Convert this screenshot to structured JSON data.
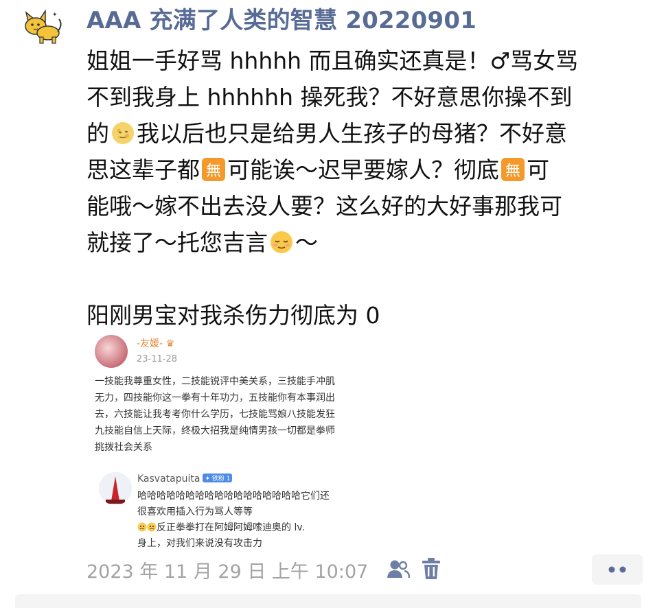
{
  "post": {
    "author": "AAA 充满了人类的智慧 20220901",
    "lines": [
      {
        "before": "姐姐一手好骂 hhhhh 而且确实还真是！♂骂女骂",
        "emoji": "",
        "after": ""
      },
      {
        "before": "不到我身上 hhhhhh 操死我？不好意思你操不到",
        "emoji": "",
        "after": ""
      },
      {
        "before": "的",
        "emoji": "moon-face",
        "after": "我以后也只是给男人生孩子的母猪？不好意"
      },
      {
        "before": "思这辈子都",
        "emoji": "no-vacancy",
        "after": "可能诶～迟早要嫁人？彻底",
        "emoji2": "no-vacancy",
        "after2": "可"
      },
      {
        "before": "能哦～嫁不出去没人要？这么好的大好事那我可",
        "emoji": "",
        "after": ""
      },
      {
        "before": "就接了～托您吉言",
        "emoji": "relieved-face",
        "after": "～"
      }
    ],
    "closing": "阳刚男宝对我杀伤力彻底为 0",
    "timestamp": "2023 年 11 月 29 日  上午 10:07"
  },
  "screenshot": {
    "post_name": "-友媛-",
    "post_date": "23-11-28",
    "post_text": "一技能我尊重女性，二技能锐评中美关系，三技能手冲肌无力，四技能你这一拳有十年功力，五技能你有本事润出去，六技能让我考考你什么学历，七技能骂娘八技能发狂九技能自信上天际，终极大招我是纯情男孩一切都是拳师挑拨社会关系",
    "reply_name": "Kasvatapuita",
    "reply_badge": "✦ 铁粉 1",
    "reply_line1": "哈哈哈哈哈哈哈哈哈哈哈哈哈哈哈哈哈它们还很喜欢用插入行为骂人等等",
    "reply_line2": "反正拳拳打在阿姆阿姆嗦迪奥的 lv.",
    "reply_line3": "身上，对我们来说没有攻击力"
  },
  "icons": {
    "avatar": "cat-avatar",
    "friends": "friends-visibility-icon",
    "delete": "trash-icon",
    "more": "more-dots-icon"
  },
  "colors": {
    "author": "#576b95",
    "meta": "#a3a3a3",
    "text": "#111111"
  }
}
